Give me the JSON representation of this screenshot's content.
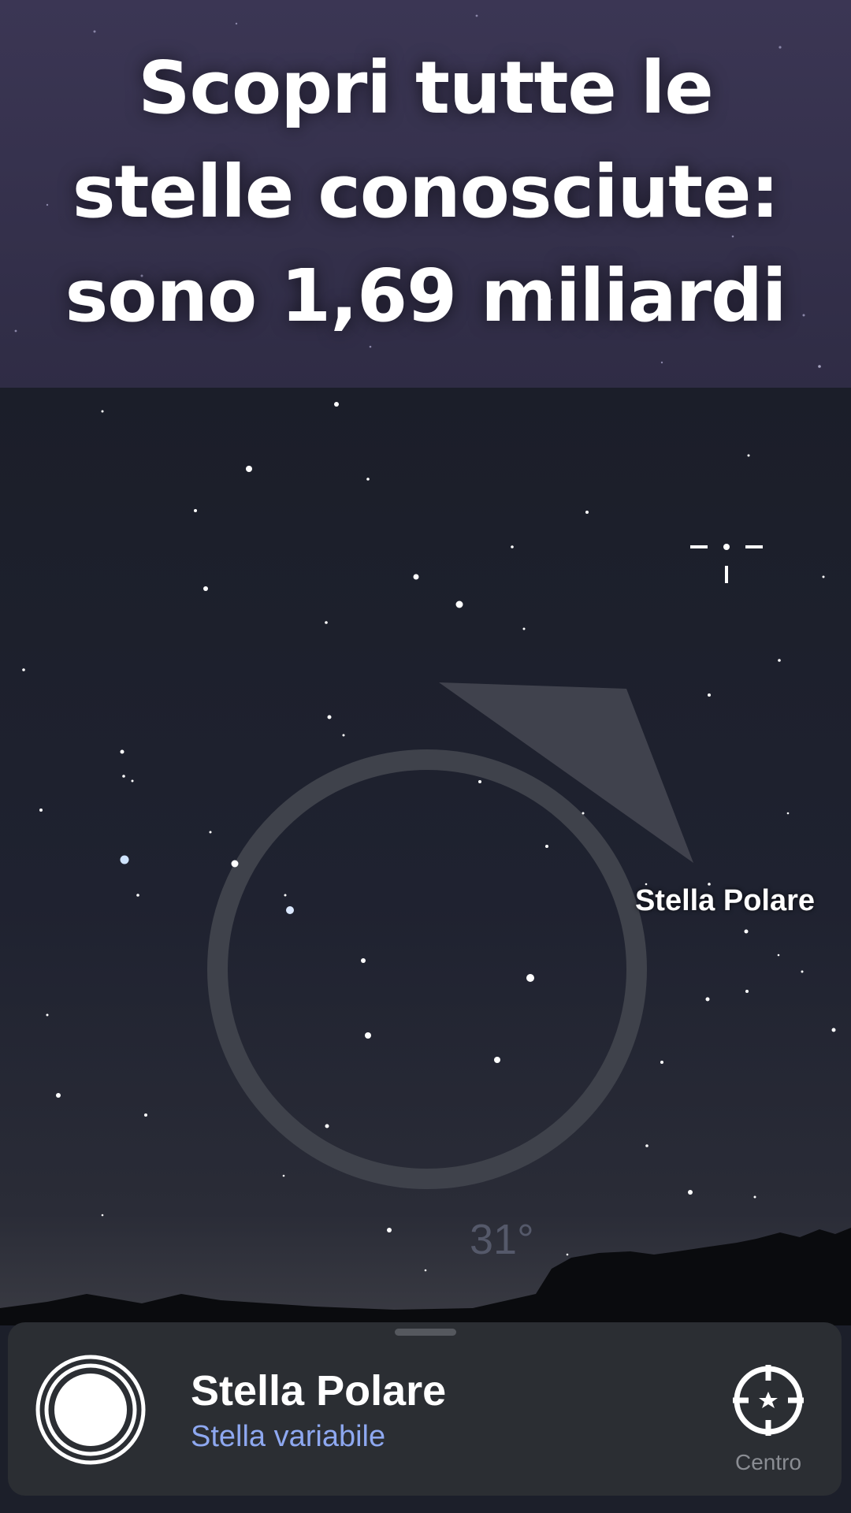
{
  "banner": {
    "title": "Scopri tutte le stelle conosciute: sono 1,69 miliardi"
  },
  "sky": {
    "target_label": "Stella Polare",
    "angle_label": "31°"
  },
  "bottom_sheet": {
    "object_name": "Stella Polare",
    "object_type": "Stella variabile",
    "center_label": "Centro",
    "object_icon": "star-object-icon",
    "center_icon": "crosshair-star-icon"
  },
  "colors": {
    "banner_bg": "#3b3654",
    "sky_bg": "#1c1f2a",
    "sheet_bg": "#2b2e33",
    "accent_blue": "#8ea8f0"
  }
}
